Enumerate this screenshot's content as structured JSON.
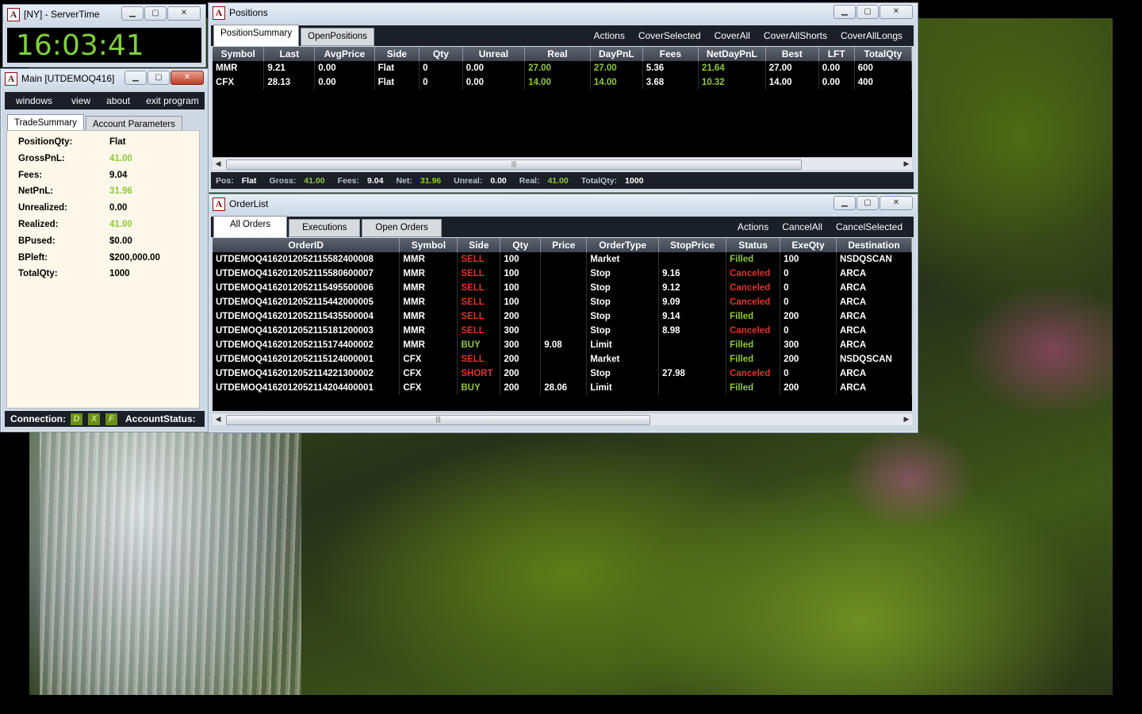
{
  "server_time": {
    "title": "[NY] - ServerTime",
    "time": "16:03:41"
  },
  "main": {
    "title": "Main [UTDEMOQ416]",
    "menu": [
      "windows",
      "view",
      "about",
      "exit program"
    ],
    "tabs": [
      "TradeSummary",
      "Account Parameters"
    ],
    "summary": [
      {
        "label": "PositionQty:",
        "value": "Flat",
        "green": false
      },
      {
        "label": "GrossPnL:",
        "value": "41.00",
        "green": true
      },
      {
        "label": "Fees:",
        "value": "9.04",
        "green": false
      },
      {
        "label": "NetPnL:",
        "value": "31.96",
        "green": true
      },
      {
        "label": "Unrealized:",
        "value": "0.00",
        "green": false
      },
      {
        "label": "Realized:",
        "value": "41.00",
        "green": true
      },
      {
        "label": "BPused:",
        "value": "$0.00",
        "green": false
      },
      {
        "label": "BPleft:",
        "value": "$200,000.00",
        "green": false
      },
      {
        "label": "TotalQty:",
        "value": "1000",
        "green": false
      }
    ],
    "status": {
      "connection_label": "Connection:",
      "indicators": [
        "D",
        "X",
        "F"
      ],
      "account_status_label": "AccountStatus:"
    }
  },
  "positions": {
    "title": "Positions",
    "tabs": [
      "PositionSummary",
      "OpenPositions"
    ],
    "actions": [
      "Actions",
      "CoverSelected",
      "CoverAll",
      "CoverAllShorts",
      "CoverAllLongs"
    ],
    "columns": [
      "Symbol",
      "Last",
      "AvgPrice",
      "Side",
      "Qty",
      "Unreal",
      "Real",
      "DayPnL",
      "Fees",
      "NetDayPnL",
      "Best",
      "LFT",
      "TotalQty"
    ],
    "rows": [
      [
        "MMR",
        "9.21",
        "0.00",
        "Flat",
        "0",
        "0.00",
        "27.00",
        "27.00",
        "5.36",
        "21.64",
        "27.00",
        "0.00",
        "600"
      ],
      [
        "CFX",
        "28.13",
        "0.00",
        "Flat",
        "0",
        "0.00",
        "14.00",
        "14.00",
        "3.68",
        "10.32",
        "14.00",
        "0.00",
        "400"
      ]
    ],
    "footer": [
      {
        "label": "Pos:",
        "value": "Flat",
        "green": false
      },
      {
        "label": "Gross:",
        "value": "41.00",
        "green": true
      },
      {
        "label": "Fees:",
        "value": "9.04",
        "green": false
      },
      {
        "label": "Net:",
        "value": "31.96",
        "green": true
      },
      {
        "label": "Unreal:",
        "value": "0.00",
        "green": false
      },
      {
        "label": "Real:",
        "value": "41.00",
        "green": true
      },
      {
        "label": "TotalQty:",
        "value": "1000",
        "green": false
      }
    ]
  },
  "orderlist": {
    "title": "OrderList",
    "tabs": [
      "All Orders",
      "Executions",
      "Open Orders"
    ],
    "actions": [
      "Actions",
      "CancelAll",
      "CancelSelected"
    ],
    "columns": [
      "OrderID",
      "Symbol",
      "Side",
      "Qty",
      "Price",
      "OrderType",
      "StopPrice",
      "Status",
      "ExeQty",
      "Destination"
    ],
    "rows": [
      [
        "UTDEMOQ4162012052115582400008",
        "MMR",
        "SELL",
        "100",
        "",
        "Market",
        "",
        "Filled",
        "100",
        "NSDQSCAN"
      ],
      [
        "UTDEMOQ4162012052115580600007",
        "MMR",
        "SELL",
        "100",
        "",
        "Stop",
        "9.16",
        "Canceled",
        "0",
        "ARCA"
      ],
      [
        "UTDEMOQ4162012052115495500006",
        "MMR",
        "SELL",
        "100",
        "",
        "Stop",
        "9.12",
        "Canceled",
        "0",
        "ARCA"
      ],
      [
        "UTDEMOQ4162012052115442000005",
        "MMR",
        "SELL",
        "100",
        "",
        "Stop",
        "9.09",
        "Canceled",
        "0",
        "ARCA"
      ],
      [
        "UTDEMOQ4162012052115435500004",
        "MMR",
        "SELL",
        "200",
        "",
        "Stop",
        "9.14",
        "Filled",
        "200",
        "ARCA"
      ],
      [
        "UTDEMOQ4162012052115181200003",
        "MMR",
        "SELL",
        "300",
        "",
        "Stop",
        "8.98",
        "Canceled",
        "0",
        "ARCA"
      ],
      [
        "UTDEMOQ4162012052115174400002",
        "MMR",
        "BUY",
        "300",
        "9.08",
        "Limit",
        "",
        "Filled",
        "300",
        "ARCA"
      ],
      [
        "UTDEMOQ4162012052115124000001",
        "CFX",
        "SELL",
        "200",
        "",
        "Market",
        "",
        "Filled",
        "200",
        "NSDQSCAN"
      ],
      [
        "UTDEMOQ4162012052114221300002",
        "CFX",
        "SHORT",
        "200",
        "",
        "Stop",
        "27.98",
        "Canceled",
        "0",
        "ARCA"
      ],
      [
        "UTDEMOQ4162012052114204400001",
        "CFX",
        "BUY",
        "200",
        "28.06",
        "Limit",
        "",
        "Filled",
        "200",
        "ARCA"
      ]
    ]
  },
  "colors": {
    "green": "#8fc93a",
    "red": "#e0332a",
    "clock": "#7fd13b"
  }
}
